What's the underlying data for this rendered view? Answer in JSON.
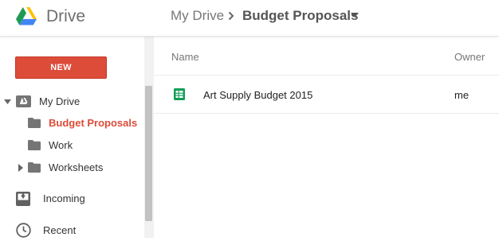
{
  "header": {
    "app_title": "Drive",
    "breadcrumb": {
      "root": "My Drive",
      "current": "Budget Proposals"
    }
  },
  "sidebar": {
    "new_button": "NEW",
    "my_drive": "My Drive",
    "folders": [
      {
        "label": "Budget Proposals",
        "active": true
      },
      {
        "label": "Work",
        "active": false
      },
      {
        "label": "Worksheets",
        "active": false,
        "expandable": true
      }
    ],
    "incoming": "Incoming",
    "recent": "Recent"
  },
  "main": {
    "columns": {
      "name": "Name",
      "owner": "Owner"
    },
    "files": [
      {
        "name": "Art Supply Budget 2015",
        "owner": "me",
        "icon": "sheets-icon"
      }
    ]
  },
  "colors": {
    "accent_red": "#dd4b39",
    "sheets_green": "#0f9d58"
  }
}
